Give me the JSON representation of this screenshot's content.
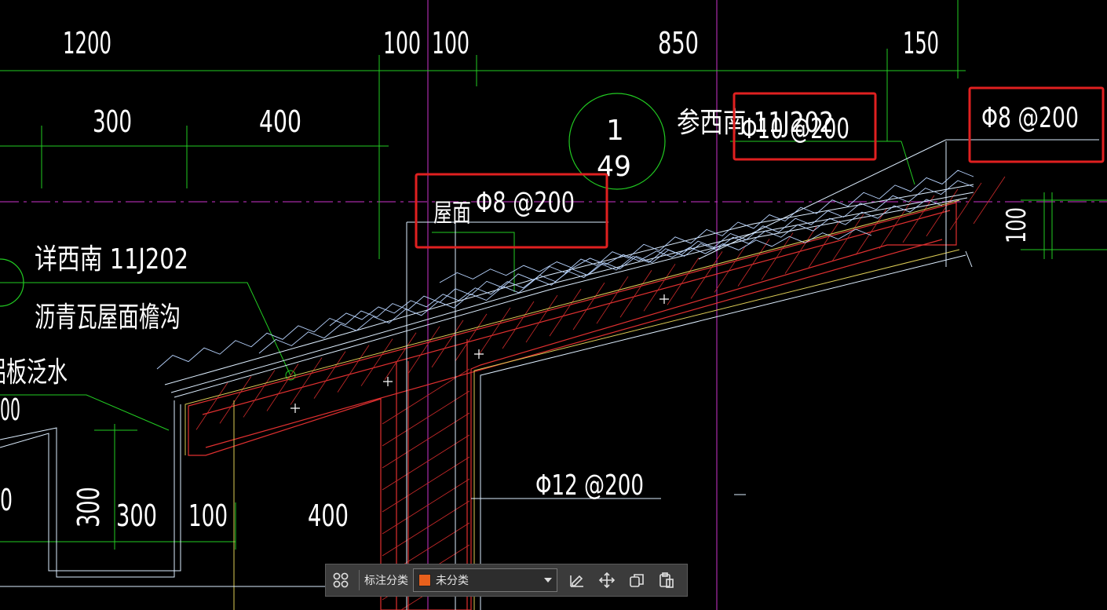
{
  "drawing": {
    "top_dims": [
      "1200",
      "100",
      "100",
      "850",
      "150"
    ],
    "second_dims": [
      "300",
      "400"
    ],
    "bottom_dims": [
      "300",
      "300",
      "100",
      "400"
    ],
    "right_dim": "100",
    "left_partial_dim": "0",
    "left_partial_dim2": "00",
    "detail_symbol": {
      "top": "1",
      "bottom": "49"
    },
    "notes": {
      "detail_ref_line1": "详西南 11J202",
      "detail_ref_line2": "沥青瓦屋面檐沟",
      "flashing": "铝板泛水",
      "roof_label": "屋面",
      "cross_ref": "参西南 11J202"
    },
    "rebar": {
      "roof": "Φ8 @200",
      "upper": "Φ10 @200",
      "right": "Φ8 @200",
      "wall": "Φ12 @200"
    }
  },
  "toolbar": {
    "category_label": "标注分类",
    "category_value": "未分类",
    "category_color": "#e8601c"
  },
  "colors": {
    "background": "#000000",
    "dim_line": "#22cc22",
    "highlight_box": "#e02020",
    "concrete": "#e03030",
    "axis": "#cc33cc"
  }
}
